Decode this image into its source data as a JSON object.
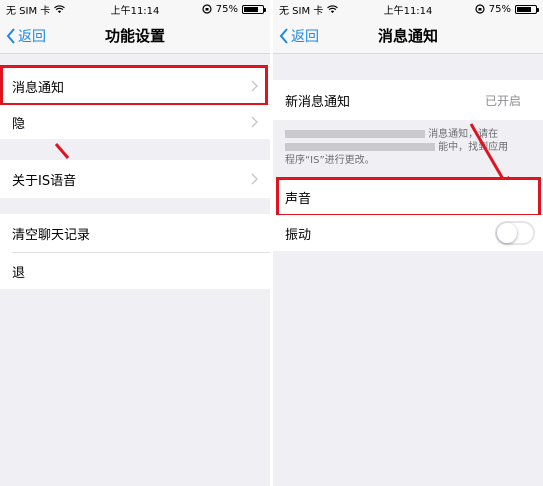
{
  "status_bar": {
    "carrier": "无 SIM 卡",
    "time": "上午11:14",
    "battery": "75%",
    "battery_level": 0.75
  },
  "left_screen": {
    "nav": {
      "back_label": "返回",
      "title": "功能设置"
    },
    "items": [
      {
        "label": "消息通知"
      },
      {
        "label": "隐"
      },
      {
        "label": "关于IS语音"
      },
      {
        "label": "清空聊天记录"
      },
      {
        "label": "退"
      }
    ]
  },
  "right_screen": {
    "nav": {
      "back_label": "返回",
      "title": "消息通知"
    },
    "new_message": {
      "label": "新消息通知",
      "value": "已开启"
    },
    "footer": {
      "line1": "消息通知，请在",
      "line2": "能中，找到应用",
      "line3": "程序“IS”进行更改。"
    },
    "sound": {
      "label": "声音"
    },
    "vibrate": {
      "label": "振动",
      "on": false
    }
  },
  "colors": {
    "accent": "#1e88e5",
    "highlight": "#e0141e",
    "background": "#efeff4"
  }
}
